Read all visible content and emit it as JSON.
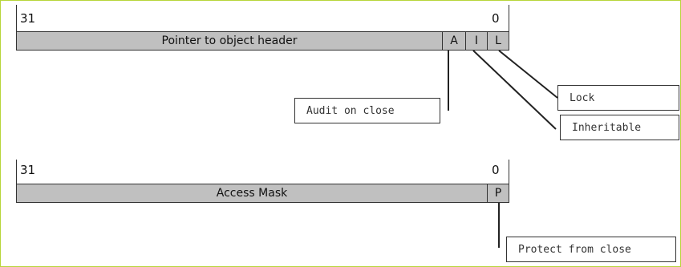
{
  "handle_entry": {
    "high_bit": "31",
    "low_bit": "0",
    "fields": {
      "pointer": "Pointer to object header",
      "audit": "A",
      "inherit": "I",
      "lock": "L"
    },
    "callouts": {
      "audit": "Audit on close",
      "lock": "Lock",
      "inherit": "Inheritable"
    }
  },
  "access_entry": {
    "high_bit": "31",
    "low_bit": "0",
    "fields": {
      "mask": "Access Mask",
      "protect": "P"
    },
    "callouts": {
      "protect": "Protect from close"
    }
  },
  "colors": {
    "field_fill": "#c0c0c0",
    "line": "#333333",
    "frame": "#b7d63a"
  }
}
